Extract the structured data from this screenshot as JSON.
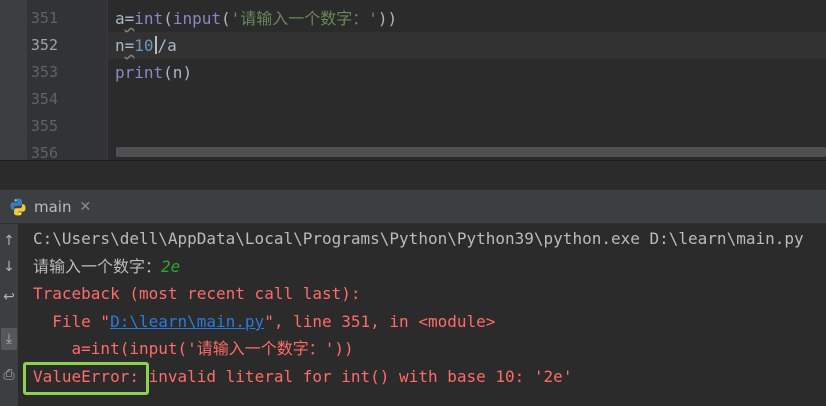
{
  "editor": {
    "line_numbers": [
      "351",
      "352",
      "353",
      "354",
      "355",
      "356"
    ],
    "current_line_index": 1,
    "code": {
      "line351": {
        "a": "a",
        "eq": "=",
        "int": "int",
        "open": "(",
        "input": "input",
        "open2": "(",
        "str": "'请输入一个数字：'",
        "close": "))"
      },
      "line352": {
        "n": "n",
        "eq": "=",
        "num": "10",
        "rest": "/a"
      },
      "line353": {
        "print": "print",
        "args": "(n)"
      }
    }
  },
  "run_tab": {
    "label": "main",
    "close": "✕",
    "icon": "python-icon"
  },
  "console": {
    "command": "C:\\Users\\dell\\AppData\\Local\\Programs\\Python\\Python39\\python.exe D:\\learn\\main.py",
    "prompt": "请输入一个数字：",
    "user_input": "2e",
    "traceback_header": "Traceback (most recent call last):",
    "file_prefix": "  File \"",
    "file_link": "D:\\learn\\main.py",
    "file_suffix": "\", line 351, in <module>",
    "source_line": "    a=int(input('请输入一个数字：'))",
    "error_type": "ValueError:",
    "error_message": " invalid literal for int() with base 10: '2e'"
  },
  "colors": {
    "keyword": "#8888c6",
    "string": "#6a8759",
    "number": "#6897bb",
    "error": "#ff6b68",
    "link": "#287bde",
    "user_input": "#2fa72f",
    "highlight_box": "#8fd14f"
  }
}
